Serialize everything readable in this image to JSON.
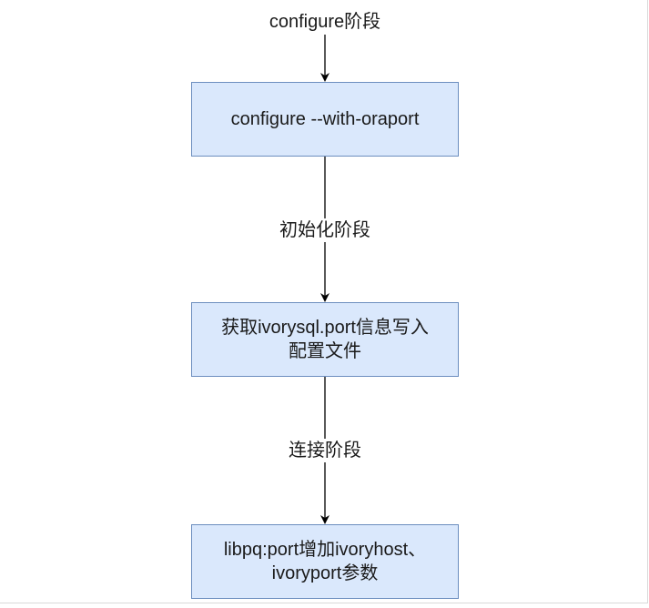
{
  "flow": {
    "stage_configure": "configure阶段",
    "step_configure": "configure --with-oraport",
    "stage_init": "初始化阶段",
    "step_read_port": "获取ivorysql.port信息写入\n配置文件",
    "stage_connect": "连接阶段",
    "step_libpq": "libpq:port增加ivoryhost、\nivoryport参数"
  },
  "colors": {
    "box_fill": "#dae8fc",
    "box_border": "#6c8ebf",
    "arrow": "#000000"
  }
}
